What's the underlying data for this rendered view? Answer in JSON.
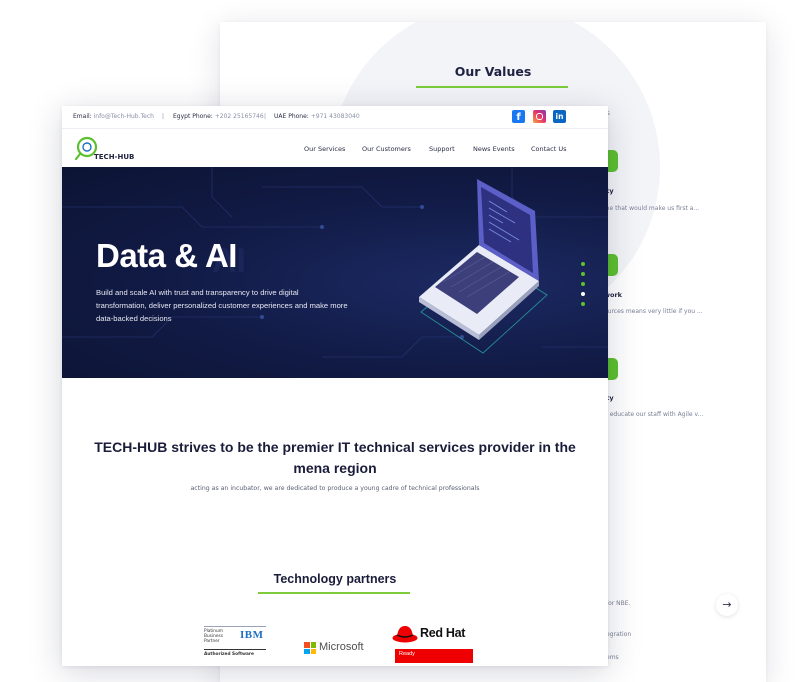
{
  "back_page": {
    "values_title": "Our Values",
    "snippet_top": "es",
    "items": [
      {
        "heading": "ity",
        "text": "lue that would make us first a..."
      },
      {
        "heading": "work",
        "text": "ources means very little if you ..."
      },
      {
        "heading": "ity",
        "text": "p educate our staff with Agile v..."
      }
    ],
    "bottom_lines": [
      "for NBE.",
      "egration",
      "ems"
    ],
    "next_icon": "arrow-right-icon"
  },
  "front_page": {
    "topbar": {
      "email_label": "Email:",
      "email_value": "info@Tech-Hub.Tech",
      "separator": "|",
      "egypt_label": "Egypt Phone:",
      "egypt_value": "+202 25165746",
      "uae_label": "UAE Phone:",
      "uae_value": "+971 43083040",
      "social": [
        {
          "name": "facebook-icon",
          "glyph": "f"
        },
        {
          "name": "instagram-icon",
          "glyph": ""
        },
        {
          "name": "linkedin-icon",
          "glyph": "in"
        }
      ]
    },
    "logo_text": "TECH-HUB",
    "nav": [
      "Our Services",
      "Our Customers",
      "Support",
      "News Events",
      "Contact Us"
    ],
    "hero": {
      "title": "Data & AI",
      "subtitle": "Build and scale AI with trust and transparency to drive digital transformation, deliver personalized customer experiences and make more data-backed decisions",
      "slide_count": 5,
      "active_slide": 4
    },
    "mission": {
      "title": "TECH-HUB strives to be the premier IT technical services provider in the mena region",
      "subtitle": "acting as an incubator, we are dedicated to produce a young cadre of technical professionals"
    },
    "partners": {
      "title": "Technology partners",
      "ibm": {
        "small": "Platinum Business Partner",
        "mark": "IBM",
        "bottom": "Authorized Software"
      },
      "microsoft": "Microsoft",
      "redhat": {
        "name": "Red Hat",
        "badge": "Ready"
      }
    }
  },
  "colors": {
    "accent_green": "#5cc02f",
    "hero_bg": "#111a44",
    "text_dark": "#1f2240"
  }
}
